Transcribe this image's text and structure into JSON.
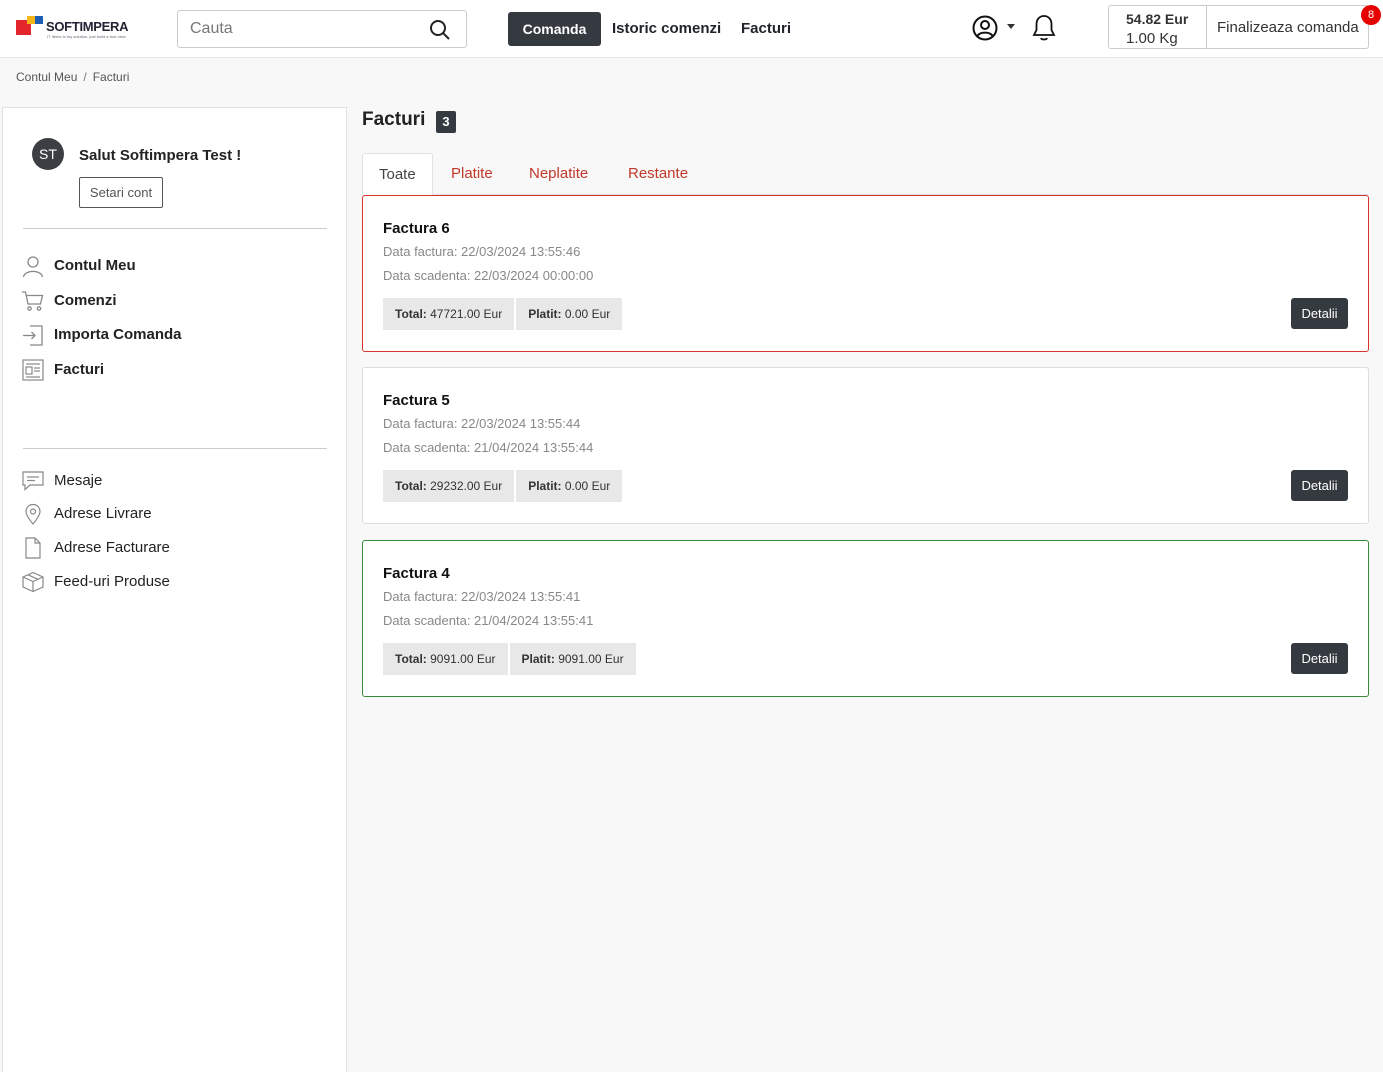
{
  "header": {
    "logo_name": "SOFTIMPERA",
    "logo_registered": "®",
    "logo_tagline": "IT Items to my solution, just build a true view",
    "search_placeholder": "Cauta",
    "nav": [
      "Comanda",
      "Istoric comenzi",
      "Facturi"
    ],
    "cart_total": "54.82 Eur",
    "cart_weight": "1.00 Kg",
    "finalize_label": "Finalizeaza comanda",
    "cart_badge": "8"
  },
  "breadcrumb": {
    "items": [
      "Contul Meu",
      "Facturi"
    ],
    "separator": "/"
  },
  "sidebar": {
    "avatar_initials": "ST",
    "greeting": "Salut Softimpera Test !",
    "settings_label": "Setari cont",
    "primary": [
      {
        "label": "Contul Meu",
        "icon": "user-icon"
      },
      {
        "label": "Comenzi",
        "icon": "cart-icon"
      },
      {
        "label": "Importa Comanda",
        "icon": "import-icon"
      },
      {
        "label": "Facturi",
        "icon": "invoice-icon"
      }
    ],
    "secondary": [
      {
        "label": "Mesaje",
        "icon": "message-icon"
      },
      {
        "label": "Adrese Livrare",
        "icon": "location-pin-icon"
      },
      {
        "label": "Adrese Facturare",
        "icon": "document-icon"
      },
      {
        "label": "Feed-uri Produse",
        "icon": "box-icon"
      }
    ]
  },
  "main": {
    "title": "Facturi",
    "count": "3",
    "tabs": [
      "Toate",
      "Platite",
      "Neplatite",
      "Restante"
    ],
    "active_tab": "Toate",
    "invoices": [
      {
        "title": "Factura 6",
        "date_text": "Data factura: 22/03/2024 13:55:46",
        "due_text": "Data scadenta: 22/03/2024 00:00:00",
        "total_label": "Total:",
        "total_value": "47721.00 Eur",
        "paid_label": "Platit:",
        "paid_value": "0.00 Eur",
        "status": "overdue",
        "button": "Detalii"
      },
      {
        "title": "Factura 5",
        "date_text": "Data factura: 22/03/2024 13:55:44",
        "due_text": "Data scadenta: 21/04/2024 13:55:44",
        "total_label": "Total:",
        "total_value": "29232.00 Eur",
        "paid_label": "Platit:",
        "paid_value": "0.00 Eur",
        "status": "unpaid",
        "button": "Detalii"
      },
      {
        "title": "Factura 4",
        "date_text": "Data factura: 22/03/2024 13:55:41",
        "due_text": "Data scadenta: 21/04/2024 13:55:41",
        "total_label": "Total:",
        "total_value": "9091.00 Eur",
        "paid_label": "Platit:",
        "paid_value": "9091.00 Eur",
        "status": "paid",
        "button": "Detalii"
      }
    ]
  },
  "colors": {
    "dark": "#343a40",
    "tab_red": "#c0392b",
    "overdue_border": "#d9342b",
    "paid_border": "#3a8a35",
    "badge_red": "#e60000"
  }
}
